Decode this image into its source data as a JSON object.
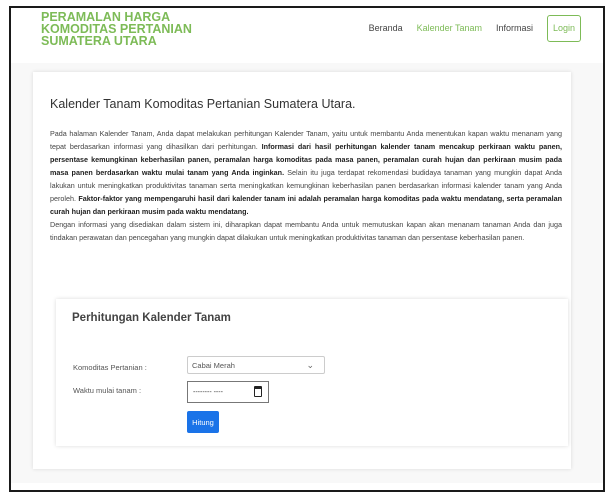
{
  "brand": {
    "line1": "PERAMALAN HARGA",
    "line2": "KOMODITAS PERTANIAN",
    "line3": "SUMATERA UTARA"
  },
  "nav": {
    "items": [
      {
        "label": "Beranda"
      },
      {
        "label": "Kalender Tanam"
      },
      {
        "label": "Informasi"
      }
    ],
    "active_index": 1,
    "login_label": "Login"
  },
  "page": {
    "title": "Kalender Tanam Komoditas Pertanian Sumatera Utara.",
    "desc": {
      "p1_a": "Pada halaman Kalender Tanam, Anda dapat melakukan perhitungan Kalender Tanam, yaitu untuk membantu Anda menentukan kapan waktu menanam yang tepat berdasarkan informasi yang dihasilkan dari perhitungan. ",
      "p1_b": "Informasi dari hasil perhitungan kalender tanam mencakup perkiraan waktu panen, persentase kemungkinan keberhasilan panen, peramalan harga komoditas pada masa panen, peramalan curah hujan dan perkiraan musim pada masa panen berdasarkan waktu mulai tanam yang Anda inginkan.",
      "p1_c": " Selain itu juga terdapat rekomendasi budidaya tanaman yang mungkin dapat Anda lakukan untuk meningkatkan produktivitas tanaman serta meningkatkan kemungkinan keberhasilan panen berdasarkan informasi kalender tanam yang Anda peroleh. ",
      "p1_d": "Faktor-faktor yang mempengaruhi hasil dari kalender tanam ini adalah peramalan harga komoditas pada waktu mendatang, serta peramalan curah hujan dan perkiraan musim pada waktu mendatang.",
      "p2": "Dengan informasi yang disediakan dalam sistem ini, diharapkan dapat membantu Anda untuk memutuskan kapan akan menanam tanaman Anda dan juga tindakan perawatan dan pencegahan yang mungkin dapat dilakukan untuk meningkatkan produktivitas tanaman dan persentase keberhasilan panen."
    }
  },
  "calc": {
    "title": "Perhitungan Kalender Tanam",
    "komoditas_label": "Komoditas Pertanian :",
    "komoditas_value": "Cabai Merah",
    "waktu_label": "Waktu mulai tanam :",
    "waktu_value": "-------- ----",
    "submit_label": "Hitung"
  },
  "icons": {
    "select_chevron": "chevron-down-icon",
    "date_picker": "calendar-icon"
  },
  "colors": {
    "brand_green": "#7dbb57",
    "button_blue": "#1a73e8"
  }
}
